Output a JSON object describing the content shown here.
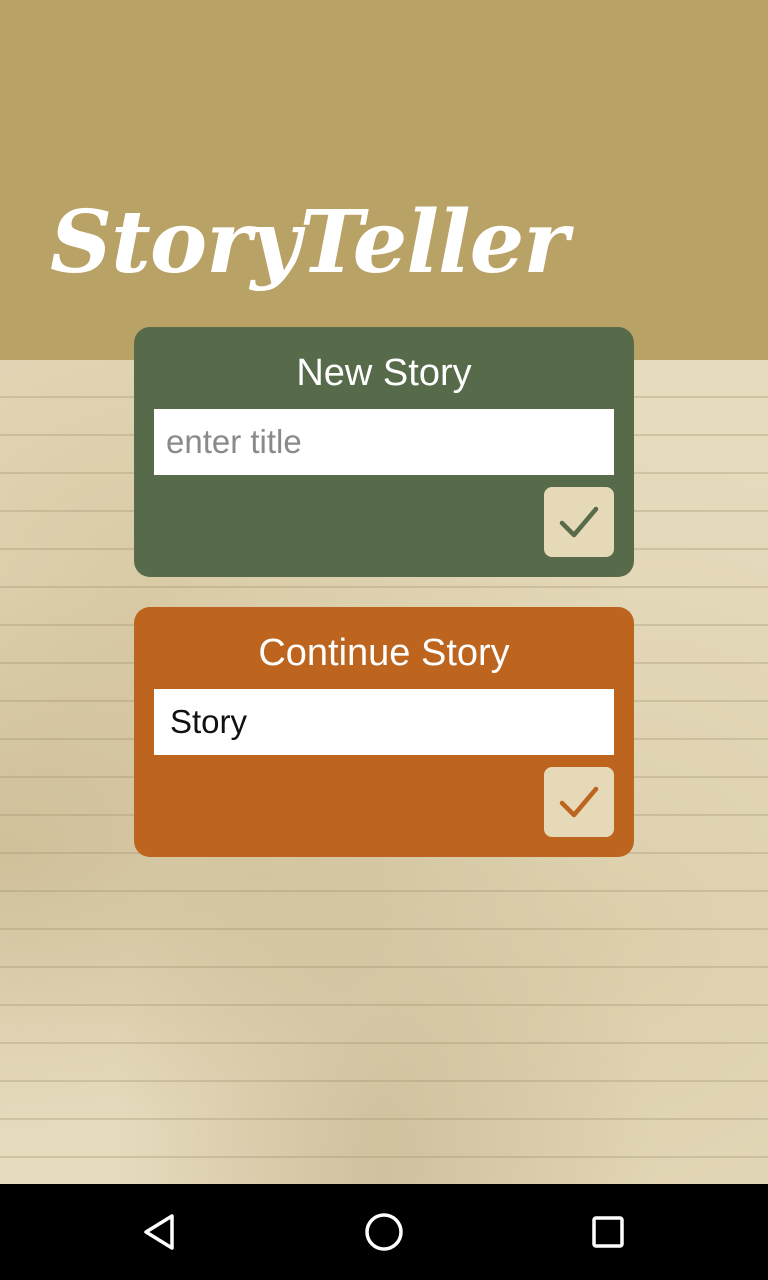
{
  "app": {
    "title": "StoryTeller"
  },
  "new_story": {
    "heading": "New Story",
    "input_value": "",
    "input_placeholder": "enter title",
    "confirm_icon": "check-icon",
    "color": "#576a4a"
  },
  "continue_story": {
    "heading": "Continue Story",
    "input_value": "Story",
    "input_placeholder": "",
    "confirm_icon": "check-icon",
    "color": "#bd641e"
  },
  "colors": {
    "header": "#b9a265",
    "button_bg": "#e6d9b7"
  },
  "navigation_bar": {
    "back_icon": "back-triangle-icon",
    "home_icon": "home-circle-icon",
    "recents_icon": "recents-square-icon"
  }
}
